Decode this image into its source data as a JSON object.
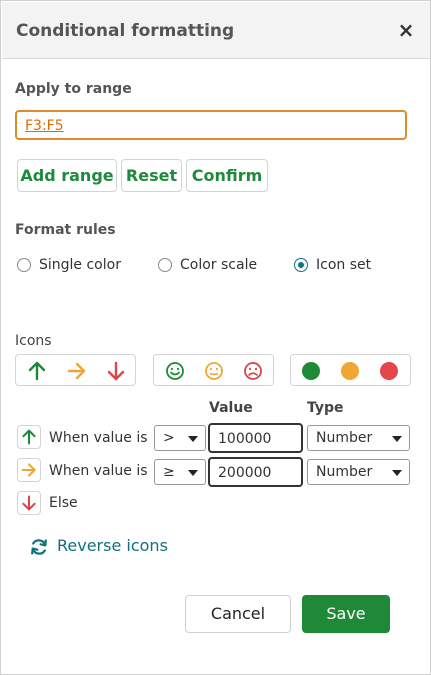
{
  "dialog": {
    "title": "Conditional formatting",
    "close_label": "×"
  },
  "apply_range": {
    "label": "Apply to range",
    "value": "F3:F5",
    "buttons": {
      "add": "Add range",
      "reset": "Reset",
      "confirm": "Confirm"
    }
  },
  "format_rules": {
    "label": "Format rules",
    "options": [
      {
        "label": "Single color",
        "selected": false
      },
      {
        "label": "Color scale",
        "selected": false
      },
      {
        "label": "Icon set",
        "selected": true
      }
    ]
  },
  "icons": {
    "label": "Icons",
    "sets": [
      {
        "name": "arrows",
        "icons": [
          "arrow-up-icon",
          "arrow-right-icon",
          "arrow-down-icon"
        ],
        "colors": [
          "#1e8a37",
          "#f0a534",
          "#d9464a"
        ]
      },
      {
        "name": "smileys",
        "icons": [
          "smile-icon",
          "neutral-face-icon",
          "frown-icon"
        ],
        "colors": [
          "#1e8a37",
          "#f0a534",
          "#d9464a"
        ]
      },
      {
        "name": "dots",
        "icons": [
          "green-dot-icon",
          "yellow-dot-icon",
          "red-dot-icon"
        ],
        "colors": [
          "#1e8a37",
          "#f0a534",
          "#e5464a"
        ]
      }
    ]
  },
  "rules": {
    "columns": {
      "value": "Value",
      "type": "Type"
    },
    "rows": [
      {
        "icon": "arrow-up-icon",
        "text": "When value is",
        "operator": ">",
        "value": "100000",
        "type": "Number"
      },
      {
        "icon": "arrow-right-icon",
        "text": "When value is",
        "operator": "≥",
        "value": "200000",
        "type": "Number"
      },
      {
        "icon": "arrow-down-icon",
        "text": "Else"
      }
    ]
  },
  "reverse": {
    "label": "Reverse icons",
    "icon": "refresh-icon"
  },
  "footer": {
    "cancel": "Cancel",
    "save": "Save"
  },
  "colors": {
    "accent": "#1e8a37",
    "teal": "#10707d",
    "range_border": "#de8b2e"
  }
}
